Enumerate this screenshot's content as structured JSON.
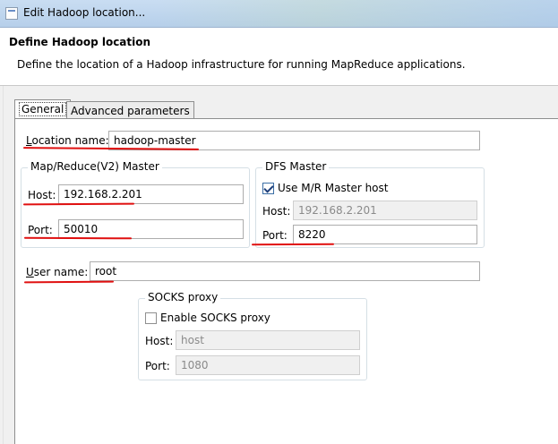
{
  "window": {
    "title": "Edit Hadoop location..."
  },
  "header": {
    "title": "Define Hadoop location",
    "description": "Define the location of a Hadoop infrastructure for running MapReduce applications."
  },
  "tabs": [
    {
      "label": "General",
      "active": true
    },
    {
      "label": "Advanced parameters",
      "active": false
    }
  ],
  "general": {
    "location_name": {
      "label_underlined": "L",
      "label_rest": "ocation name:",
      "value": "hadoop-master"
    },
    "mr_master": {
      "title": "Map/Reduce(V2) Master",
      "host": {
        "label": "Host:",
        "value": "192.168.2.201"
      },
      "port": {
        "label": "Port:",
        "value": "50010"
      }
    },
    "dfs_master": {
      "title": "DFS Master",
      "use_mr_host": {
        "label": "Use M/R Master host",
        "checked": true
      },
      "host": {
        "label": "Host:",
        "value": "192.168.2.201"
      },
      "port": {
        "label": "Port:",
        "value": "8220"
      }
    },
    "user_name": {
      "label_underlined": "U",
      "label_rest": "ser name:",
      "value": "root"
    },
    "socks": {
      "title": "SOCKS proxy",
      "enable": {
        "label": "Enable SOCKS proxy",
        "checked": false
      },
      "host": {
        "label": "Host:",
        "placeholder": "host"
      },
      "port": {
        "label": "Port:",
        "placeholder": "1080"
      }
    }
  },
  "annotation_color": "#e01010"
}
